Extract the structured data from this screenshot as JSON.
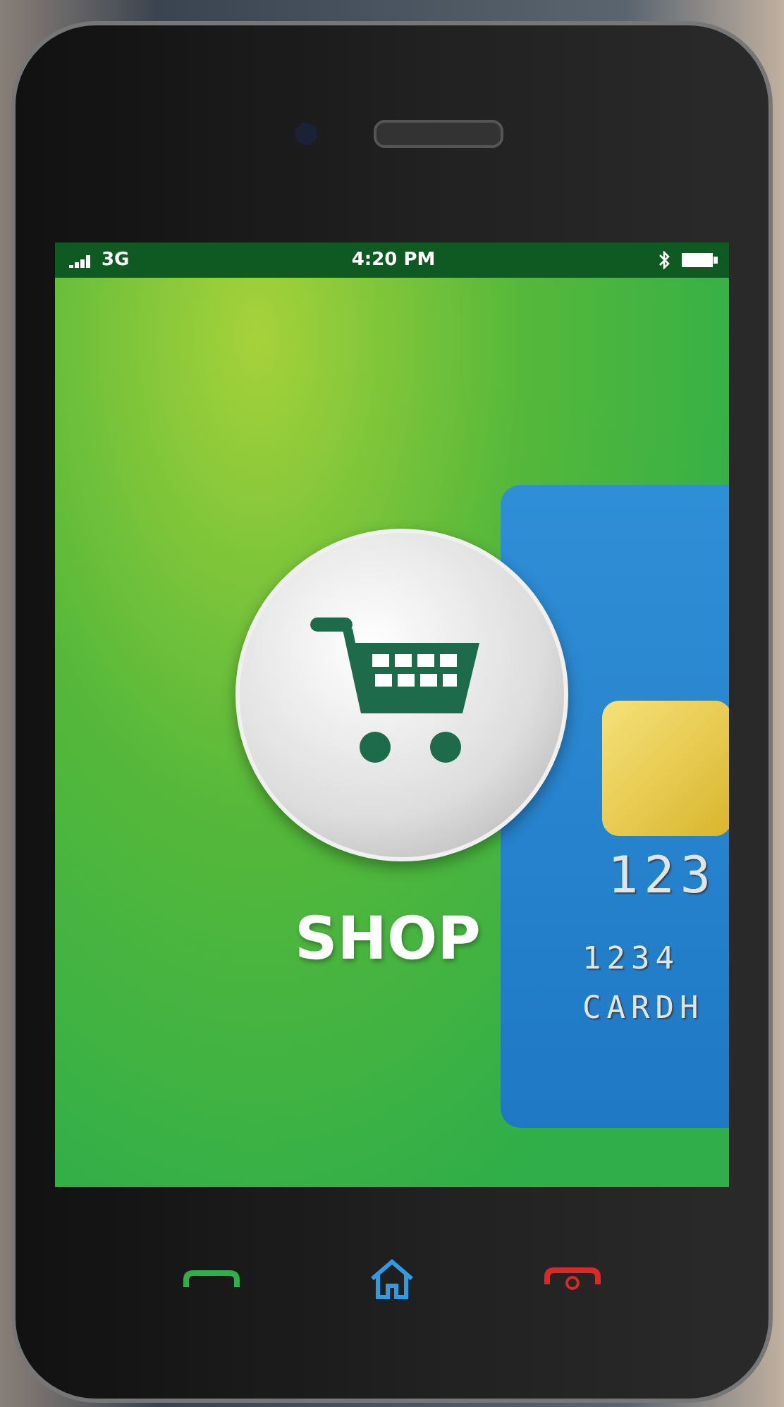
{
  "status_bar": {
    "network": "3G",
    "time": "4:20 PM"
  },
  "app_tile": {
    "label": "SHOP"
  },
  "card": {
    "number_partial": "123",
    "line_2": "1234",
    "line_3": "CARDH"
  }
}
